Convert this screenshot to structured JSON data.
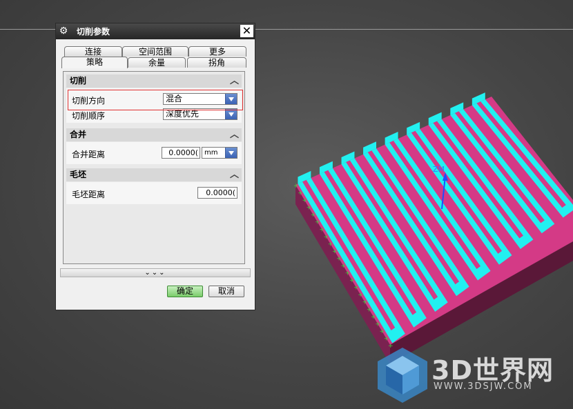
{
  "dialog": {
    "title": "切削参数",
    "icon": "gear-icon",
    "tabs_row1": [
      "连接",
      "空间范围",
      "更多"
    ],
    "tabs_row2": [
      "策略",
      "余量",
      "拐角"
    ],
    "active_tab": "策略",
    "sections": {
      "cut": {
        "title": "切削",
        "direction_label": "切削方向",
        "direction_value": "混合",
        "order_label": "切削顺序",
        "order_value": "深度优先"
      },
      "merge": {
        "title": "合并",
        "distance_label": "合并距离",
        "distance_value": "0.0000(",
        "unit": "mm"
      },
      "blank": {
        "title": "毛坯",
        "distance_label": "毛坯距离",
        "distance_value": "0.0000("
      }
    },
    "more_glyph": "⌄⌄⌄",
    "ok_label": "确定",
    "cancel_label": "取消"
  },
  "viewport": {
    "axis_label": "ZM",
    "colors": {
      "top": "#22f0f0",
      "groove": "#d43a86",
      "side_dark": "#5a1838",
      "side_mid": "#7a2250",
      "edge_marks": "#3cd23c"
    }
  },
  "watermark": {
    "brand": "3D世界网",
    "url": "WWW.3DSJW.COM"
  }
}
